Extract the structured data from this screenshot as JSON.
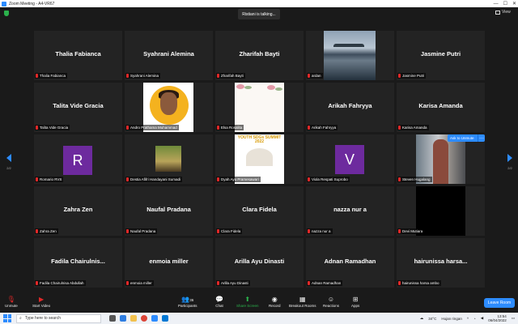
{
  "window": {
    "title": "Zoom Meeting - A4-VR67"
  },
  "window_controls": [
    "—",
    "☐",
    "✕"
  ],
  "topbar": {
    "talking": "Ristiani is talking...",
    "view_label": "View",
    "pager_left": "2/2",
    "pager_right": "2/2"
  },
  "tiles": [
    {
      "name": "Thalia Fabianca",
      "label": "Thalia Fabianca"
    },
    {
      "name": "Syahrani Alemina",
      "label": "Syahrani Alemina"
    },
    {
      "name": "Zharifah Bayti",
      "label": "Zharifah Bayti"
    },
    {
      "name": "",
      "label": "ardan"
    },
    {
      "name": "Jasmine Putri",
      "label": "Jasmine Putri"
    },
    {
      "name": "Talita Vide Gracia",
      "label": "Talita Vide Gracia"
    },
    {
      "name": "",
      "label": "Andro Prathama Muhammad"
    },
    {
      "name": "",
      "label": "Elsa Rosalita"
    },
    {
      "name": "Arikah Fahryya",
      "label": "Arikah Fahryya"
    },
    {
      "name": "Karisa Amanda",
      "label": "Karisa Amanda"
    },
    {
      "name": "",
      "label": "Romario RVS",
      "letter": "R"
    },
    {
      "name": "",
      "label": "Destia Afifri Handayani Sumadi"
    },
    {
      "name": "",
      "label": "Dyah Ayu Pramesawari",
      "poster_title": "YOUTH SDGs SUMMIT 2022"
    },
    {
      "name": "",
      "label": "Viola Respati Suprobo",
      "letter": "V"
    },
    {
      "name": "",
      "label": "Steven Hugalang"
    },
    {
      "name": "Zahra Zen",
      "label": "Zahra Zen"
    },
    {
      "name": "Naufal Pradana",
      "label": "Naufal Pradana"
    },
    {
      "name": "Clara Fidela",
      "label": "Clara Fidela"
    },
    {
      "name": "nazza nur a",
      "label": "nazza nur a"
    },
    {
      "name": "",
      "label": "Devi Mutiara"
    },
    {
      "name": "Fadila Chairulnis...",
      "label": "Fadila Chairulnisa Abdullah"
    },
    {
      "name": "enmoia miller",
      "label": "enmoia miller"
    },
    {
      "name": "Arilla Ayu Dinasti",
      "label": "Arilla Ayu Dinasti"
    },
    {
      "name": "Adnan Ramadhan",
      "label": "Adnan Ramadhan"
    },
    {
      "name": "hairunissa harsa...",
      "label": "hairunissa harsa ambo"
    }
  ],
  "ask_to_unmute": {
    "label": "Ask to Unmute",
    "more": "···"
  },
  "toolbar": {
    "unmute": "Unmute",
    "start_video": "Start Video",
    "participants": "Participants",
    "participants_count": "36",
    "chat": "Chat",
    "share_screen": "Share Screen",
    "record": "Record",
    "breakout_rooms": "Breakout Rooms",
    "reactions": "Reactions",
    "apps": "Apps",
    "leave": "Leave Room"
  },
  "taskbar": {
    "search_placeholder": "Type here to search",
    "weather": "34°C",
    "weather_text": "Hujan ringan",
    "time": "13:54",
    "date": "06/04/2022"
  },
  "colors": {
    "accent": "#2d8cff",
    "muted_red": "#e02828",
    "share_green": "#2bb24c",
    "avatar_purple": "#6d2a9e"
  }
}
